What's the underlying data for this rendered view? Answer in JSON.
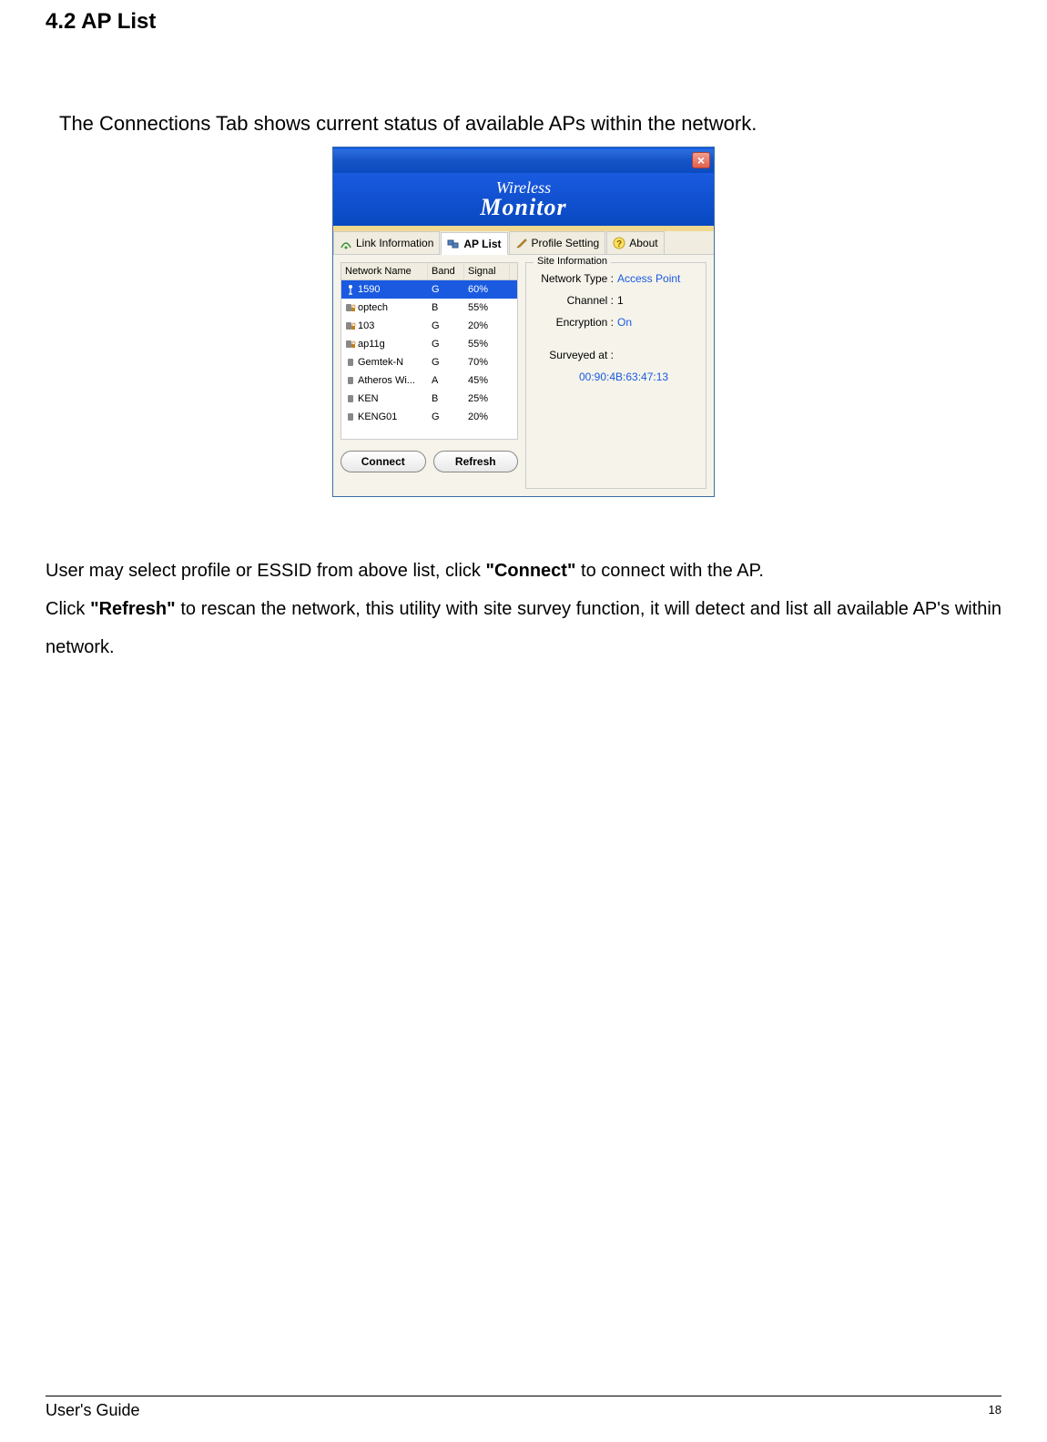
{
  "section_title": "4.2 AP List",
  "intro": "The Connections Tab shows current status of available APs within the network.",
  "window": {
    "logo_top": "Wireless",
    "logo_bottom": "Monitor",
    "tabs": {
      "link_info": "Link Information",
      "ap_list": "AP List",
      "profile": "Profile Setting",
      "about": "About"
    },
    "list_headers": {
      "name": "Network Name",
      "band": "Band",
      "signal": "Signal"
    },
    "rows": [
      {
        "name": "1590",
        "band": "G",
        "signal": "60%",
        "locked": true,
        "selected": true
      },
      {
        "name": "optech",
        "band": "B",
        "signal": "55%",
        "locked": true
      },
      {
        "name": "103",
        "band": "G",
        "signal": "20%",
        "locked": true
      },
      {
        "name": "ap11g",
        "band": "G",
        "signal": "55%",
        "locked": true
      },
      {
        "name": "Gemtek-N",
        "band": "G",
        "signal": "70%",
        "locked": false
      },
      {
        "name": "Atheros Wi...",
        "band": "A",
        "signal": "45%",
        "locked": false
      },
      {
        "name": "KEN",
        "band": "B",
        "signal": "25%",
        "locked": false
      },
      {
        "name": "KENG01",
        "band": "G",
        "signal": "20%",
        "locked": false
      }
    ],
    "buttons": {
      "connect": "Connect",
      "refresh": "Refresh"
    },
    "info": {
      "title": "Site Information",
      "network_type_label": "Network Type :",
      "network_type_value": "Access Point",
      "channel_label": "Channel :",
      "channel_value": "1",
      "encryption_label": "Encryption :",
      "encryption_value": "On",
      "surveyed_label": "Surveyed at :",
      "mac": "00:90:4B:63:47:13"
    }
  },
  "body": {
    "p1_a": "User may select profile or ESSID from above list, click ",
    "p1_b": "\"Connect\"",
    "p1_c": " to connect with the AP.",
    "p2_a": "Click ",
    "p2_b": "\"Refresh\"",
    "p2_c": " to rescan the network, this utility with site survey function, it will detect and list all available AP's within network."
  },
  "footer": {
    "guide": "User's Guide",
    "page": "18"
  }
}
